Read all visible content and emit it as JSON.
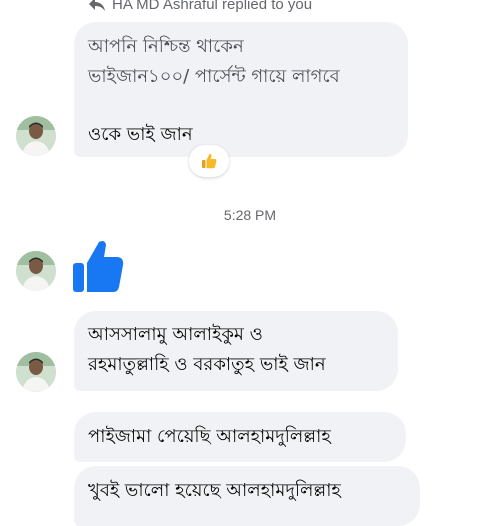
{
  "reply_header": {
    "text": "HA MD Ashraful replied to you"
  },
  "messages": [
    {
      "lines": [
        "আপনি নিশ্চিন্ত থাকেন",
        "ভাইজান১০০/ পার্সেন্ট গায়ে লাগবে",
        "",
        "ওকে ভাই জান"
      ],
      "reaction": "like-emoji"
    },
    {
      "lines": [
        "আসসালামু আলাইকুম ও",
        "রহমাতুল্লাহি ও বরকাতুহ ভাই জান"
      ]
    },
    {
      "lines": [
        "পাইজামা পেয়েছি আলহামদুলিল্লাহ"
      ]
    },
    {
      "lines": [
        "খুবই ভালো হয়েছে আলহামদুলিল্লাহ"
      ]
    }
  ],
  "timestamp": "5:28 PM",
  "colors": {
    "bubble_bg": "#f0f2f5",
    "messenger_blue": "#1877f2",
    "reaction_yellow": "#f7b928",
    "secondary_text": "#65676b"
  },
  "icons": {
    "reply": "reply-arrow-icon",
    "reaction": "thumbs-up-emoji-icon",
    "sent_like": "thumbs-up-icon"
  }
}
